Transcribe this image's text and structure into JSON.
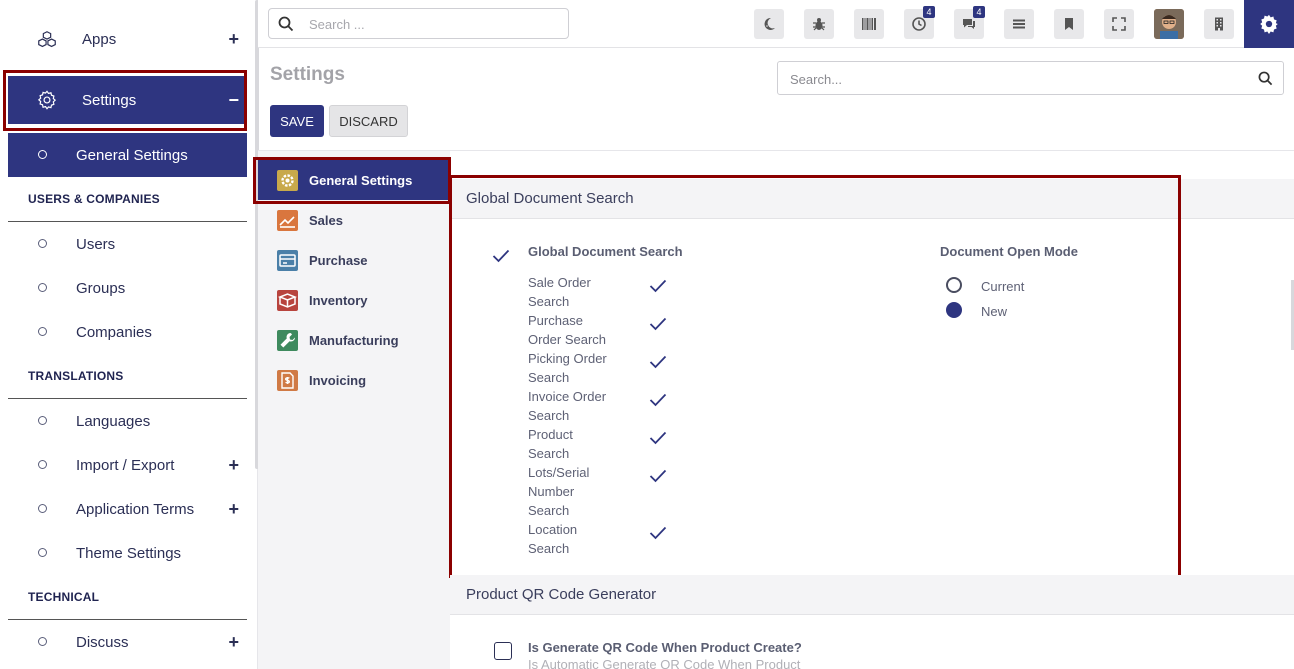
{
  "sidebar": {
    "apps_label": "Apps",
    "settings_label": "Settings",
    "general_settings_label": "General Settings",
    "sections": {
      "users_companies": "USERS & COMPANIES",
      "translations": "TRANSLATIONS",
      "technical": "TECHNICAL"
    },
    "items": {
      "users": "Users",
      "groups": "Groups",
      "companies": "Companies",
      "languages": "Languages",
      "import_export": "Import / Export",
      "application_terms": "Application Terms",
      "theme_settings": "Theme Settings",
      "discuss": "Discuss"
    },
    "plus": "+",
    "minus": "−"
  },
  "topbar": {
    "search_placeholder": "Search ...",
    "activity_badge": "4",
    "messages_badge": "4"
  },
  "control_panel": {
    "title": "Settings",
    "save_label": "SAVE",
    "discard_label": "DISCARD",
    "search_placeholder": "Search..."
  },
  "apps": {
    "general_settings": "General Settings",
    "sales": "Sales",
    "purchase": "Purchase",
    "inventory": "Inventory",
    "manufacturing": "Manufacturing",
    "invoicing": "Invoicing"
  },
  "global_search": {
    "section_title": "Global Document Search",
    "main_label": "Global Document Search",
    "lines": [
      "Sale Order",
      "Search",
      "Purchase",
      "Order Search",
      "Picking Order",
      "Search",
      "Invoice Order",
      "Search",
      "Product",
      "Search",
      "Lots/Serial",
      "Number",
      "Search",
      "Location",
      "Search"
    ],
    "open_mode_label": "Document Open Mode",
    "open_mode_options": [
      "Current",
      "New"
    ],
    "open_mode_selected": "New"
  },
  "qr_section": {
    "section_title": "Product QR Code Generator",
    "checkbox_label": "Is Generate QR Code When Product Create?",
    "checkbox_help": "Is Automatic Generate QR Code When Product"
  },
  "colors": {
    "primary": "#2e3580",
    "highlight": "#8b0000"
  }
}
